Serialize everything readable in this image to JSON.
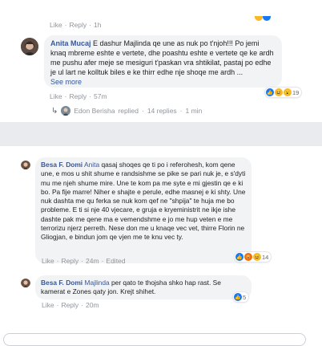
{
  "block1": {
    "top_meta": {
      "like": "Like",
      "reply": "Reply",
      "time": "1h"
    },
    "comment": {
      "author": "Anita Mucaj",
      "text": "E dashur Majlinda qe une as nuk po t'njoh!!! Po jemi knaq mbreme eshte e vertete, dhe poashtu eshte e vertete qe ke ardh me pushu afer meje se mesiguri t'paskan vra shtikilat, pastaj po edhe je ul lart ne kolltuk biles e ke thirr edhe nje shoqe me ardh ...",
      "see_more": "See more",
      "reaction_count": "19",
      "like": "Like",
      "reply": "Reply",
      "time": "57m"
    },
    "replies": {
      "author": "Edon Berisha",
      "replied": "replied",
      "count": "14 replies",
      "time": "1 min"
    }
  },
  "block2": {
    "comment1": {
      "author": "Besa F. Domi",
      "tag": "Anita",
      "text": "qasaj shoqes qe ti po i referohesh, kom qene une, e mos u shit shume e randsishme se pike se pari nuk je, e s'dyti mu me njeh shume mire. Une te kom pa me syte e mi gjestin qe e ki bo. Pa fije marre! Niher e shajte e perule, edhe masnej e ki shty. Une nuk dashta me qu ferka se nuk kom qef ne \"shpija\" te huja me bo probleme. E ti si nje 40 vjecare, e gruja e kryeministrit ne ikje ishe dashte pak me qene ma e vemendshme e jo me hup veten e me terrorizu njerz perreth. Nese don me u knaqe vec vet, thirre Florin ne Gliogjan, e bindun jom qe vjen me te knu vec ty.",
      "reaction_count": "14",
      "like": "Like",
      "reply": "Reply",
      "time": "24m",
      "edited": "Edited"
    },
    "comment2": {
      "author": "Besa F. Domi",
      "tag": "Majlinda",
      "text": "per qato te thojsha shko hap rast. Se kamerat e Zones qaty jon. Krejt shihet.",
      "reaction_count": "5",
      "like": "Like",
      "reply": "Reply",
      "time": "20m"
    }
  },
  "separator": "·",
  "colors": {
    "link": "#385898",
    "bubble": "#f2f3f5",
    "gap": "#e9ebee",
    "meta": "#90949c"
  }
}
